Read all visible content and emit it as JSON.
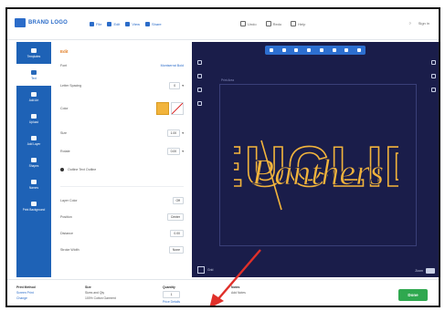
{
  "header": {
    "logo_text": "BRAND LOGO",
    "tools": [
      "File",
      "Edit",
      "View",
      "Share"
    ],
    "actions": [
      "Undo",
      "Redo",
      "Help"
    ],
    "right": [
      "?",
      "Sign in"
    ]
  },
  "leftnav": {
    "items": [
      {
        "label": "Templates"
      },
      {
        "label": "Text"
      },
      {
        "label": "Add Art"
      },
      {
        "label": "Upload"
      },
      {
        "label": "Add Layer"
      },
      {
        "label": "Shapes"
      },
      {
        "label": "Names"
      },
      {
        "label": "Print Background"
      }
    ],
    "active_index": 1
  },
  "panel": {
    "title": "Edit",
    "rows": {
      "font_label": "Font",
      "font_value": "Montserrat Bold",
      "spacing_label": "Letter Spacing",
      "spacing_value": "0",
      "color_label": "Color",
      "size_label": "Size",
      "size_value": "1.00",
      "rotate_label": "Rotate",
      "rotate_value": "0.00",
      "outline_label": "Outline Text Outline",
      "layer_label": "Layer Color",
      "layer_value": "Off",
      "position_label": "Position",
      "position_value": "Center",
      "distance_label": "Distance",
      "distance_value": "0.00",
      "stroke_label": "Stroke Width",
      "stroke_value": "None"
    },
    "color_hex": "#f2b43c"
  },
  "canvas": {
    "artboard_label": "Print Area",
    "design_word_outline": "EUCLID",
    "design_word_script": "Panthers",
    "design_color": "#f2b43c",
    "background": "#1a1d4a",
    "bottom_left": "Grid",
    "bottom_right": "Zoom"
  },
  "bottom": {
    "col1_head": "Print Method",
    "col1_line1": "Screen Print",
    "col1_line2": "Change",
    "col2_head": "Size",
    "col2_line1": "Sizes and Qty",
    "col2_line2": "100% Cotton Garment",
    "col3_head": "Quantity",
    "col3_line1": "1",
    "col3_line2": "Price Details",
    "col4_head": "Notes",
    "col4_line1": "Add Notes",
    "done_label": "Done"
  }
}
